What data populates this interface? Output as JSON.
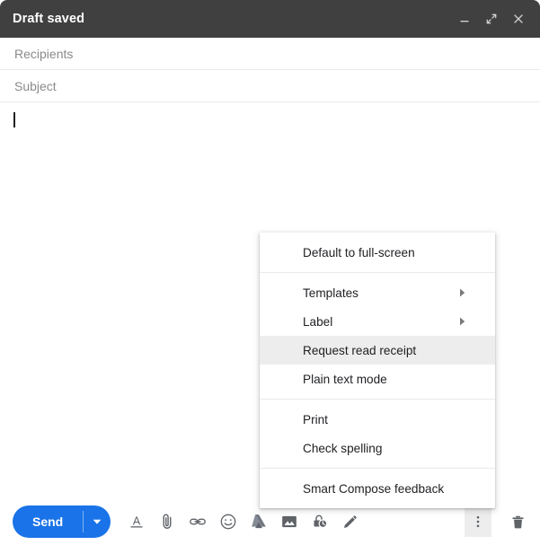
{
  "window": {
    "title": "Draft saved",
    "controls": [
      {
        "name": "minimize",
        "label": "Minimize"
      },
      {
        "name": "expand",
        "label": "Full screen"
      },
      {
        "name": "close",
        "label": "Close"
      }
    ]
  },
  "fields": {
    "recipients": {
      "placeholder": "Recipients",
      "value": ""
    },
    "subject": {
      "placeholder": "Subject",
      "value": ""
    },
    "body": {
      "value": ""
    }
  },
  "more_menu": {
    "sections": [
      {
        "items": [
          {
            "label": "Default to full-screen",
            "submenu": false,
            "highlighted": false
          }
        ]
      },
      {
        "items": [
          {
            "label": "Templates",
            "submenu": true,
            "highlighted": false
          },
          {
            "label": "Label",
            "submenu": true,
            "highlighted": false
          },
          {
            "label": "Request read receipt",
            "submenu": false,
            "highlighted": true
          },
          {
            "label": "Plain text mode",
            "submenu": false,
            "highlighted": false
          }
        ]
      },
      {
        "items": [
          {
            "label": "Print",
            "submenu": false,
            "highlighted": false
          },
          {
            "label": "Check spelling",
            "submenu": false,
            "highlighted": false
          }
        ]
      },
      {
        "items": [
          {
            "label": "Smart Compose feedback",
            "submenu": false,
            "highlighted": false
          }
        ]
      }
    ]
  },
  "toolbar": {
    "send_label": "Send",
    "send_options_label": "More send options",
    "icons": [
      {
        "name": "formatting-options-icon",
        "label": "Formatting options"
      },
      {
        "name": "attach-file-icon",
        "label": "Attach files"
      },
      {
        "name": "insert-link-icon",
        "label": "Insert link"
      },
      {
        "name": "insert-emoji-icon",
        "label": "Insert emoji"
      },
      {
        "name": "insert-drive-icon",
        "label": "Insert files using Drive"
      },
      {
        "name": "insert-photo-icon",
        "label": "Insert photo"
      },
      {
        "name": "confidential-mode-icon",
        "label": "Toggle confidential mode"
      },
      {
        "name": "insert-signature-icon",
        "label": "Insert signature"
      }
    ],
    "more_options_label": "More options",
    "discard_label": "Discard draft"
  },
  "colors": {
    "header_bg": "#404040",
    "accent_blue": "#1a73e8",
    "menu_highlight": "#ededed",
    "icon_gray": "#5f6368",
    "placeholder_gray": "#8a8a8a"
  }
}
